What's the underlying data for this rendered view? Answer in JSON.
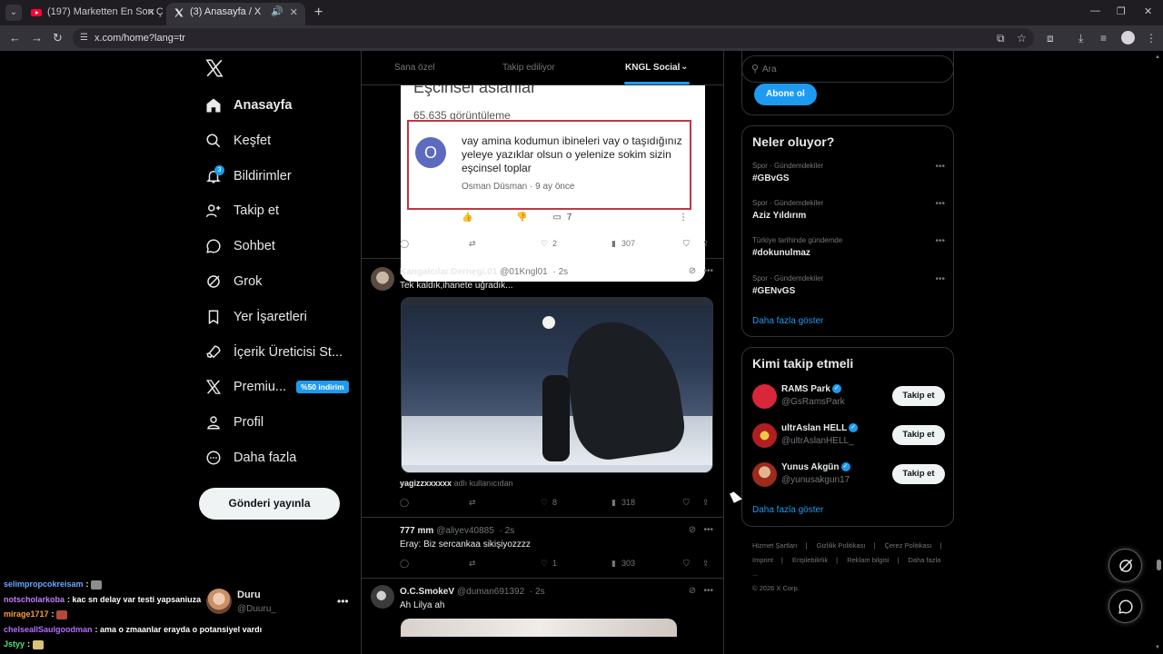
{
  "browser": {
    "tabs": [
      {
        "title": "(197) Marketten En Son Çıkan 2",
        "icon": "youtube-icon"
      },
      {
        "title": "(3) Anasayfa / X",
        "icon": "x-icon"
      }
    ],
    "url": "x.com/home?lang=tr"
  },
  "sidebar": {
    "items": [
      {
        "label": "Anasayfa",
        "icon": "home-icon"
      },
      {
        "label": "Keşfet",
        "icon": "search-icon"
      },
      {
        "label": "Bildirimler",
        "icon": "bell-icon",
        "badge": "3"
      },
      {
        "label": "Takip et",
        "icon": "person-add-icon"
      },
      {
        "label": "Sohbet",
        "icon": "chat-icon"
      },
      {
        "label": "Grok",
        "icon": "grok-icon"
      },
      {
        "label": "Yer İşaretleri",
        "icon": "bookmark-icon"
      },
      {
        "label": "İçerik Üreticisi St...",
        "icon": "rocket-icon"
      },
      {
        "label": "Premiu...",
        "icon": "x-icon",
        "tag": "%50 indirim"
      },
      {
        "label": "Profil",
        "icon": "profile-icon"
      },
      {
        "label": "Daha fazla",
        "icon": "more-circle-icon"
      }
    ],
    "post_button": "Gönderi yayınla",
    "account": {
      "name": "Duru",
      "handle": "@Duuru_"
    }
  },
  "chat": [
    {
      "user": "selimpropcokreisam",
      "user_color": "#6aa8ff",
      "text": ""
    },
    {
      "user": "notscholarkoba",
      "user_color": "#c77dff",
      "text": "kac sn delay var testi yapsaniuza"
    },
    {
      "user": "mirage1717",
      "user_color": "#ff9d3c",
      "text": ""
    },
    {
      "user": "chelseaIlSaulgoodman",
      "user_color": "#b56cff",
      "text": "ama o zmaanlar erayda o potansiyel vardı"
    },
    {
      "user": "Jstyy",
      "user_color": "#4fe07a",
      "text": ""
    }
  ],
  "timeline": {
    "tabs": [
      "Sana özel",
      "Takip ediliyor",
      "KNGL Social"
    ],
    "embed": {
      "title": "Eşcinsel aslanlar",
      "views": "65.635 görüntüleme",
      "avatar_letter": "O",
      "comment": "vay amina kodumun ibineleri vay o taşıdığınız yeleye yazıklar olsun o yelenize sokim sizin eşcinsel toplar",
      "author": "Osman Düsman · 9 ay önce",
      "replies_count": "7"
    },
    "tweet1_actions": {
      "replies": "",
      "reposts": "",
      "likes": "2",
      "views": "307"
    },
    "tweets": [
      {
        "name": "Kangalcılar.Dernegi.01",
        "handle": "@01Kngl01",
        "time": "2s",
        "text": "Tek kaldık,ihanete uğradık...",
        "media_caption_user": "yagizzxxxxxx",
        "media_caption": "adlı kullanıcıdan",
        "likes": "8",
        "views": "318"
      },
      {
        "name": "777 mm",
        "handle": "@aliyev40885",
        "time": "2s",
        "text": "Eray: Biz sercankaa sikişiyozzzz",
        "likes": "1",
        "views": "303"
      },
      {
        "name": "O.C.SmokeV",
        "handle": "@duman691392",
        "time": "2s",
        "text": "Ah Lilya ah"
      }
    ]
  },
  "right": {
    "search_placeholder": "Ara",
    "subscribe_button": "Abone ol",
    "trends_title": "Neler oluyor?",
    "trends": [
      {
        "category": "Spor · Gündemdekiler",
        "tag": "#GBvGS"
      },
      {
        "category": "Spor · Gündemdekiler",
        "tag": "Aziz Yıldırım"
      },
      {
        "category": "Türkiye tarihinde gündemde",
        "tag": "#dokunulmaz"
      },
      {
        "category": "Spor · Gündemdekiler",
        "tag": "#GENvGS"
      }
    ],
    "show_more": "Daha fazla göster",
    "who_title": "Kimi takip etmeli",
    "suggestions": [
      {
        "name": "RAMS Park",
        "handle": "@GsRamsPark",
        "button": "Takip et",
        "color": "#d8263a"
      },
      {
        "name": "ultrAslan HELL",
        "handle": "@ultrAslanHELL_",
        "button": "Takip et",
        "color": "#b01e22"
      },
      {
        "name": "Yunus Akgün",
        "handle": "@yunusakgun17",
        "button": "Takip et",
        "color": "#9c2a1d"
      }
    ],
    "footer": [
      "Hizmet Şartları",
      "Gizlilik Politikası",
      "Çerez Politikası",
      "Imprint",
      "Erişilebilirlik",
      "Reklam bilgisi",
      "Daha fazla ...",
      "© 2026 X Corp."
    ]
  },
  "colors": {
    "accent": "#1d9bf0",
    "background": "#000000",
    "text": "#e7e9ea",
    "muted": "#71767b"
  }
}
